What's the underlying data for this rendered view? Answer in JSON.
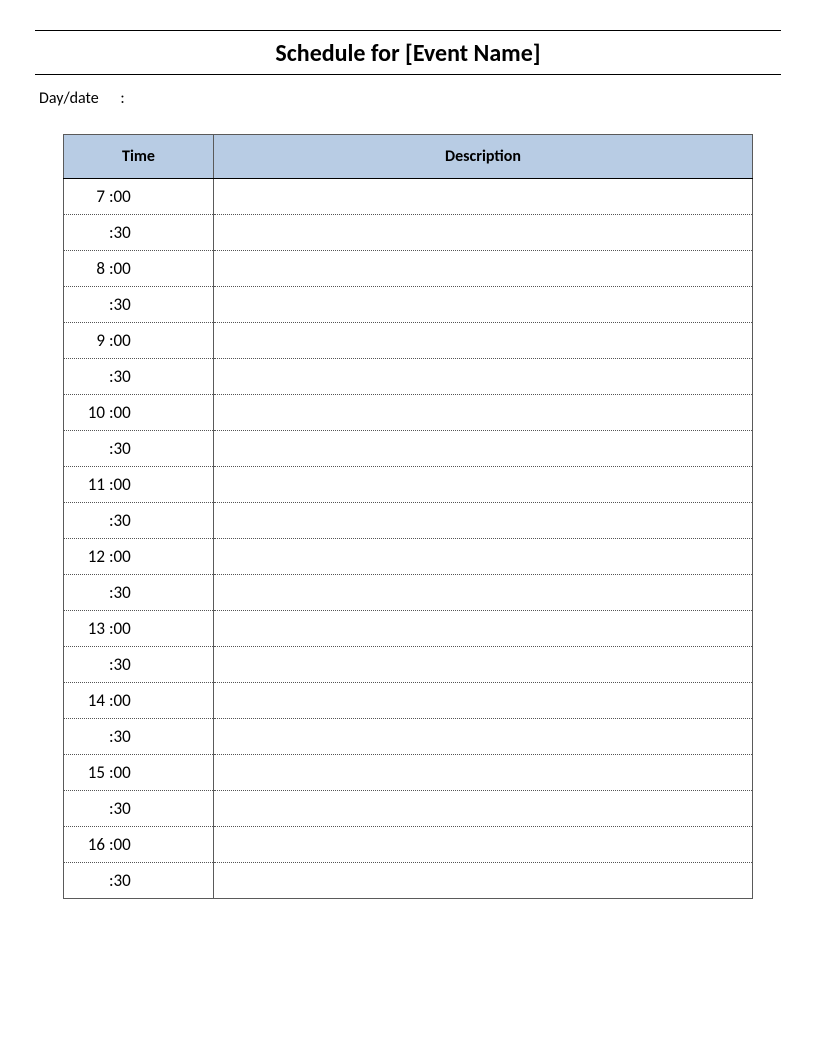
{
  "title": "Schedule for [Event Name]",
  "daydate_label": "Day/date",
  "daydate_sep": ":",
  "daydate_value": "",
  "columns": {
    "time": "Time",
    "description": "Description"
  },
  "rows": [
    {
      "hour": "7",
      "minute": ":00",
      "description": ""
    },
    {
      "hour": "",
      "minute": ":30",
      "description": ""
    },
    {
      "hour": "8",
      "minute": ":00",
      "description": ""
    },
    {
      "hour": "",
      "minute": ":30",
      "description": ""
    },
    {
      "hour": "9",
      "minute": ":00",
      "description": ""
    },
    {
      "hour": "",
      "minute": ":30",
      "description": ""
    },
    {
      "hour": "10",
      "minute": ":00",
      "description": ""
    },
    {
      "hour": "",
      "minute": ":30",
      "description": ""
    },
    {
      "hour": "11",
      "minute": ":00",
      "description": ""
    },
    {
      "hour": "",
      "minute": ":30",
      "description": ""
    },
    {
      "hour": "12",
      "minute": ":00",
      "description": ""
    },
    {
      "hour": "",
      "minute": ":30",
      "description": ""
    },
    {
      "hour": "13",
      "minute": ":00",
      "description": ""
    },
    {
      "hour": "",
      "minute": ":30",
      "description": ""
    },
    {
      "hour": "14",
      "minute": ":00",
      "description": ""
    },
    {
      "hour": "",
      "minute": ":30",
      "description": ""
    },
    {
      "hour": "15",
      "minute": ":00",
      "description": ""
    },
    {
      "hour": "",
      "minute": ":30",
      "description": ""
    },
    {
      "hour": "16",
      "minute": ":00",
      "description": ""
    },
    {
      "hour": "",
      "minute": ":30",
      "description": ""
    }
  ]
}
